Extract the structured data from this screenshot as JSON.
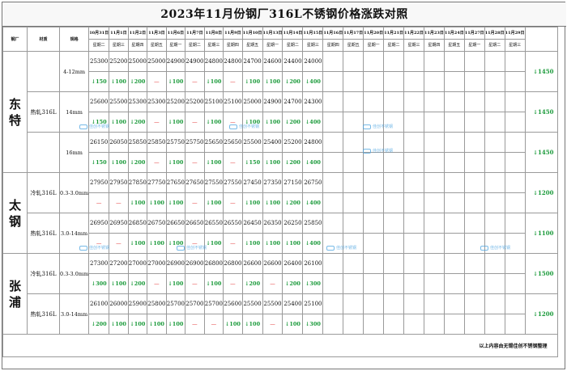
{
  "title": "2023年11月份钢厂316L不锈钢价格涨跌对照",
  "headers": {
    "mill": "钢厂",
    "material": "材质",
    "spec": "规格"
  },
  "dates": [
    "10月31日",
    "11月1日",
    "11月2日",
    "11月3日",
    "11月6日",
    "11月7日",
    "11月8日",
    "11月9日",
    "11月10日",
    "11月13日",
    "11月14日",
    "11月15日",
    "11月16日",
    "11月17日",
    "11月20日",
    "11月21日",
    "11月22日",
    "11月23日",
    "11月24日",
    "11月27日",
    "11月28日",
    "11月29日"
  ],
  "weekdays": [
    "星期二",
    "星期三",
    "星期四",
    "星期五",
    "星期一",
    "星期二",
    "星期三",
    "星期四",
    "星期五",
    "星期一",
    "星期二",
    "星期三",
    "星期四",
    "星期五",
    "星期一",
    "星期二",
    "星期三",
    "星期四",
    "星期五",
    "星期一",
    "星期二",
    "星期三"
  ],
  "mills": [
    {
      "name": "东特",
      "rows": [
        {
          "material": "",
          "spec": "4-12mm",
          "prices": [
            "25300",
            "25200",
            "25000",
            "25000",
            "24900",
            "24900",
            "24800",
            "24800",
            "24700",
            "24600",
            "24400",
            "24000"
          ],
          "changes": [
            {
              "t": "↓150",
              "c": "down"
            },
            {
              "t": "↓100",
              "c": "down"
            },
            {
              "t": "↓200",
              "c": "down"
            },
            {
              "t": "—",
              "c": "flat"
            },
            {
              "t": "↓100",
              "c": "down"
            },
            {
              "t": "—",
              "c": "flat"
            },
            {
              "t": "↓100",
              "c": "down"
            },
            {
              "t": "—",
              "c": "flat"
            },
            {
              "t": "↓100",
              "c": "down"
            },
            {
              "t": "↓100",
              "c": "down"
            },
            {
              "t": "↓200",
              "c": "down"
            },
            {
              "t": "↓400",
              "c": "down"
            }
          ],
          "net": "↓1450"
        },
        {
          "material": "热轧316L",
          "spec": "14mm",
          "prices": [
            "25600",
            "25500",
            "25300",
            "25300",
            "25200",
            "25200",
            "25100",
            "25100",
            "25000",
            "24900",
            "24700",
            "24300"
          ],
          "changes": [
            {
              "t": "↓150",
              "c": "down"
            },
            {
              "t": "↓100",
              "c": "down"
            },
            {
              "t": "↓200",
              "c": "down"
            },
            {
              "t": "—",
              "c": "flat"
            },
            {
              "t": "↓100",
              "c": "down"
            },
            {
              "t": "—",
              "c": "flat"
            },
            {
              "t": "↓100",
              "c": "down"
            },
            {
              "t": "—",
              "c": "flat"
            },
            {
              "t": "↓100",
              "c": "down"
            },
            {
              "t": "↓100",
              "c": "down"
            },
            {
              "t": "↓200",
              "c": "down"
            },
            {
              "t": "↓400",
              "c": "down"
            }
          ],
          "net": "↓1450"
        },
        {
          "material": "",
          "spec": "16mm",
          "prices": [
            "26150",
            "26050",
            "25850",
            "25850",
            "25750",
            "25750",
            "25650",
            "25650",
            "25500",
            "25400",
            "25200",
            "24800"
          ],
          "changes": [
            {
              "t": "↓150",
              "c": "down"
            },
            {
              "t": "↓100",
              "c": "down"
            },
            {
              "t": "↓200",
              "c": "down"
            },
            {
              "t": "—",
              "c": "flat"
            },
            {
              "t": "↓100",
              "c": "down"
            },
            {
              "t": "—",
              "c": "flat"
            },
            {
              "t": "↓100",
              "c": "down"
            },
            {
              "t": "—",
              "c": "flat"
            },
            {
              "t": "↓150",
              "c": "down"
            },
            {
              "t": "↓100",
              "c": "down"
            },
            {
              "t": "↓200",
              "c": "down"
            },
            {
              "t": "↓400",
              "c": "down"
            }
          ],
          "net": "↓1450"
        }
      ]
    },
    {
      "name": "太钢",
      "rows": [
        {
          "material": "冷轧316L",
          "spec": "0.3-3.0mm",
          "prices": [
            "27950",
            "27950",
            "27850",
            "27750",
            "27650",
            "27650",
            "27550",
            "27550",
            "27450",
            "27350",
            "27150",
            "26750"
          ],
          "changes": [
            {
              "t": "—",
              "c": "flat"
            },
            {
              "t": "—",
              "c": "flat"
            },
            {
              "t": "↓100",
              "c": "down"
            },
            {
              "t": "↓100",
              "c": "down"
            },
            {
              "t": "↓100",
              "c": "down"
            },
            {
              "t": "—",
              "c": "flat"
            },
            {
              "t": "↓100",
              "c": "down"
            },
            {
              "t": "—",
              "c": "flat"
            },
            {
              "t": "↓100",
              "c": "down"
            },
            {
              "t": "↓100",
              "c": "down"
            },
            {
              "t": "↓200",
              "c": "down"
            },
            {
              "t": "↓400",
              "c": "down"
            }
          ],
          "net": "↓1200"
        },
        {
          "material": "热轧316L",
          "spec": "3.0-14mm",
          "prices": [
            "26950",
            "26950",
            "26850",
            "26750",
            "26650",
            "26650",
            "26550",
            "26550",
            "26450",
            "26350",
            "26250",
            "25850"
          ],
          "changes": [
            {
              "t": "—",
              "c": "flat"
            },
            {
              "t": "—",
              "c": "flat"
            },
            {
              "t": "↓100",
              "c": "down"
            },
            {
              "t": "↓100",
              "c": "down"
            },
            {
              "t": "↓100",
              "c": "down"
            },
            {
              "t": "—",
              "c": "flat"
            },
            {
              "t": "↓100",
              "c": "down"
            },
            {
              "t": "—",
              "c": "flat"
            },
            {
              "t": "↓100",
              "c": "down"
            },
            {
              "t": "↓100",
              "c": "down"
            },
            {
              "t": "↓100",
              "c": "down"
            },
            {
              "t": "↓400",
              "c": "down"
            }
          ],
          "net": "↓1100"
        }
      ]
    },
    {
      "name": "张浦",
      "rows": [
        {
          "material": "冷轧316L",
          "spec": "0.3-3.0mm",
          "prices": [
            "27300",
            "27200",
            "27000",
            "27000",
            "26900",
            "26900",
            "26800",
            "26800",
            "26600",
            "26600",
            "26400",
            "26100"
          ],
          "changes": [
            {
              "t": "↓300",
              "c": "down"
            },
            {
              "t": "↓100",
              "c": "down"
            },
            {
              "t": "↓200",
              "c": "down"
            },
            {
              "t": "—",
              "c": "flat"
            },
            {
              "t": "↓100",
              "c": "down"
            },
            {
              "t": "—",
              "c": "flat"
            },
            {
              "t": "↓100",
              "c": "down"
            },
            {
              "t": "—",
              "c": "flat"
            },
            {
              "t": "↓200",
              "c": "down"
            },
            {
              "t": "—",
              "c": "flat"
            },
            {
              "t": "↓200",
              "c": "down"
            },
            {
              "t": "↓300",
              "c": "down"
            }
          ],
          "net": "↓1500"
        },
        {
          "material": "热轧316L",
          "spec": "3.0-14mm",
          "prices": [
            "26100",
            "26000",
            "25900",
            "25800",
            "25700",
            "25700",
            "25700",
            "25600",
            "25500",
            "25500",
            "25400",
            "25100"
          ],
          "changes": [
            {
              "t": "↓200",
              "c": "down"
            },
            {
              "t": "↓100",
              "c": "down"
            },
            {
              "t": "↓100",
              "c": "down"
            },
            {
              "t": "↓100",
              "c": "down"
            },
            {
              "t": "↓100",
              "c": "down"
            },
            {
              "t": "—",
              "c": "flat"
            },
            {
              "t": "—",
              "c": "flat"
            },
            {
              "t": "↓100",
              "c": "down"
            },
            {
              "t": "↓100",
              "c": "down"
            },
            {
              "t": "—",
              "c": "flat"
            },
            {
              "t": "↓100",
              "c": "down"
            },
            {
              "t": "↓300",
              "c": "down"
            }
          ],
          "net": "↓1200"
        }
      ]
    }
  ],
  "footer": "以上内容由无锡佳创不锈钢整理",
  "watermark": "佳创不锈钢"
}
